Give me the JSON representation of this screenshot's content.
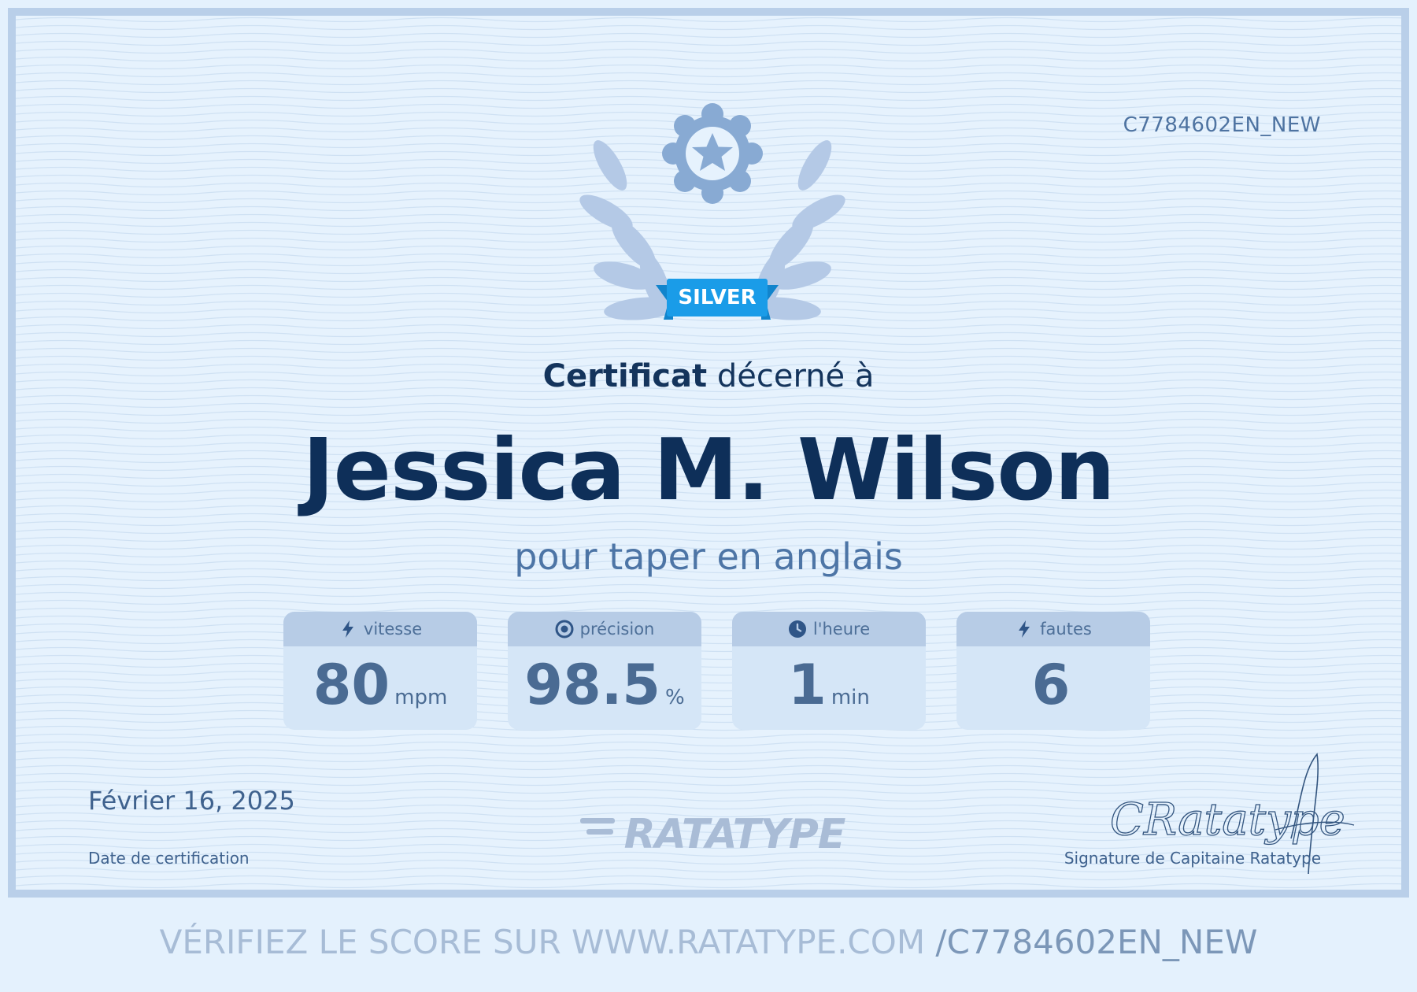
{
  "certificate": {
    "id": "C7784602EN_NEW",
    "badge": "SILVER",
    "awarded_bold": "Certificat",
    "awarded_rest": "décerné à",
    "recipient": "Jessica M. Wilson",
    "subject": "pour taper en anglais",
    "date": "Février 16, 2025",
    "date_label": "Date de certification",
    "logo_text": "RATATYPE",
    "signature_text": "CRatatype",
    "signature_label": "Signature de Capitaine Ratatype"
  },
  "stats": [
    {
      "label": "vitesse",
      "value": "80",
      "unit": "mpm",
      "icon": "lightning-icon"
    },
    {
      "label": "précision",
      "value": "98.5",
      "unit": "%",
      "icon": "target-icon"
    },
    {
      "label": "l'heure",
      "value": "1",
      "unit": "min",
      "icon": "clock-icon"
    },
    {
      "label": "fautes",
      "value": "6",
      "unit": "",
      "icon": "lightning-icon"
    }
  ],
  "verify": {
    "prefix": "VÉRIFIEZ LE SCORE SUR WWW.RATATYPE.COM",
    "code": "/C7784602EN_NEW"
  },
  "colors": {
    "background": "#e6f2fd",
    "border": "#b9cfe9",
    "title_dark": "#0e2f59",
    "accent_blue": "#1a9ce8",
    "text_mid": "#4d75a6"
  }
}
